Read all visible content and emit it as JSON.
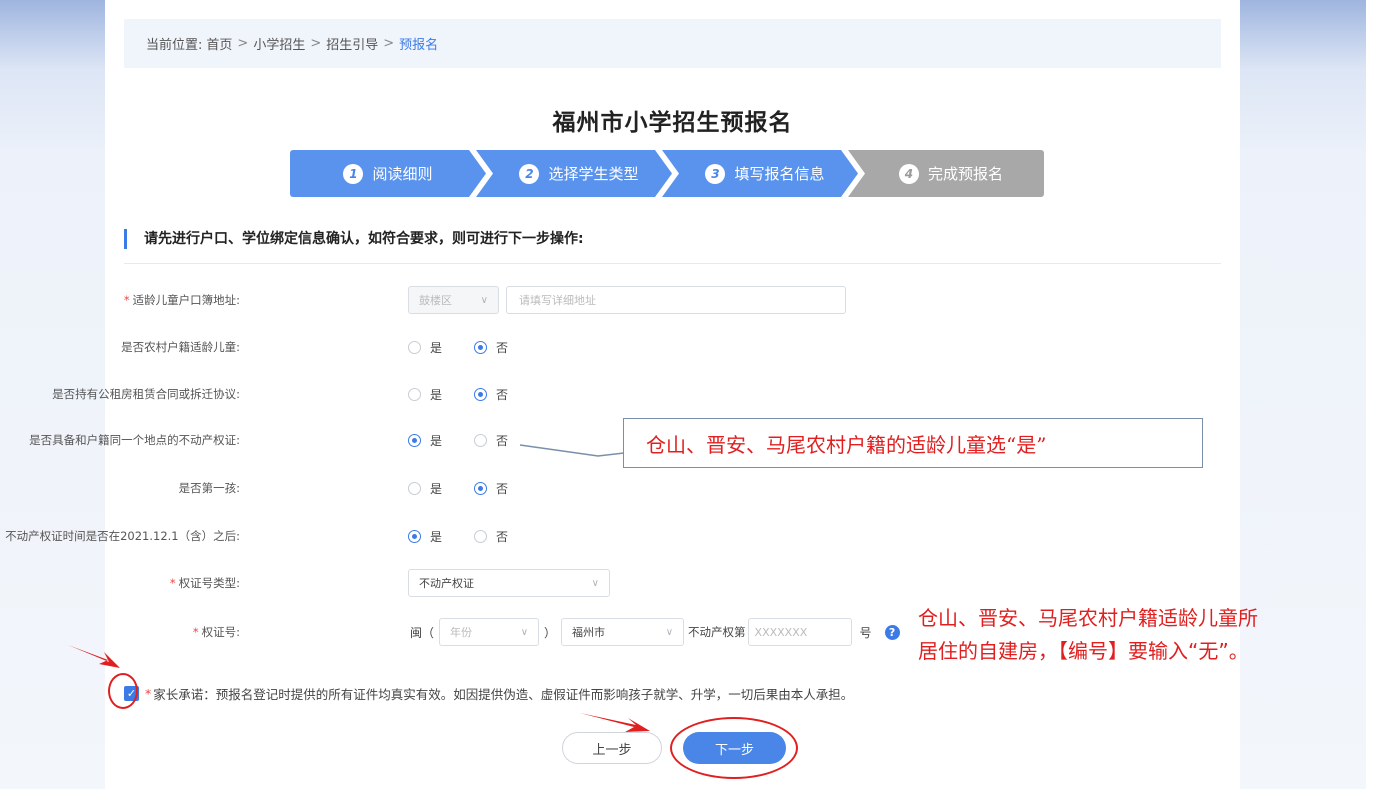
{
  "breadcrumb": {
    "prefix": "当前位置:",
    "items": [
      "首页",
      "小学招生",
      "招生引导"
    ],
    "separator": ">",
    "current": "预报名"
  },
  "page_title": "福州市小学招生预报名",
  "steps": [
    {
      "num": "1",
      "label": "阅读细则",
      "state": "done"
    },
    {
      "num": "2",
      "label": "选择学生类型",
      "state": "done"
    },
    {
      "num": "3",
      "label": "填写报名信息",
      "state": "active"
    },
    {
      "num": "4",
      "label": "完成预报名",
      "state": "pending"
    }
  ],
  "section_heading": "请先进行户口、学位绑定信息确认，如符合要求，则可进行下一步操作:",
  "form": {
    "address": {
      "label": "适龄儿童户口簿地址:",
      "district": "鼓楼区",
      "detail_placeholder": "请填写详细地址"
    },
    "rural": {
      "label": "是否农村户籍适龄儿童:",
      "yes": "是",
      "no": "否",
      "selected": "no"
    },
    "rent": {
      "label": "是否持有公租房租赁合同或拆迁协议:",
      "yes": "是",
      "no": "否",
      "selected": "no"
    },
    "property": {
      "label": "是否具备和户籍同一个地点的不动产权证:",
      "yes": "是",
      "no": "否",
      "selected": "yes"
    },
    "first_child": {
      "label": "是否第一孩:",
      "yes": "是",
      "no": "否",
      "selected": "no"
    },
    "cert_date": {
      "label": "不动产权证时间是否在2021.12.1（含）之后:",
      "yes": "是",
      "no": "否",
      "selected": "yes"
    },
    "cert_type": {
      "label": "权证号类型:",
      "value": "不动产权证"
    },
    "cert_no": {
      "label": "权证号:",
      "prefix": "闽（",
      "year_placeholder": "年份",
      "close_paren": "）",
      "city": "福州市",
      "middle": "不动产权第",
      "number_placeholder": "XXXXXXX",
      "suffix": "号"
    }
  },
  "promise": {
    "text": "家长承诺：预报名登记时提供的所有证件均真实有效。如因提供伪造、虚假证件而影响孩子就学、升学，一切后果由本人承担。",
    "checked": true
  },
  "buttons": {
    "prev": "上一步",
    "next": "下一步"
  },
  "annotations": {
    "callout": "仓山、晋安、马尾农村户籍的适龄儿童选“是”",
    "side_line1": "仓山、晋安、马尾农村户籍适龄儿童所",
    "side_line2": "居住的自建房，【编号】要输入“无”。"
  },
  "colors": {
    "accent": "#3c7be6",
    "step_active": "#5a93ee",
    "step_pending": "#a8a8a8",
    "annotation": "#e02020"
  }
}
